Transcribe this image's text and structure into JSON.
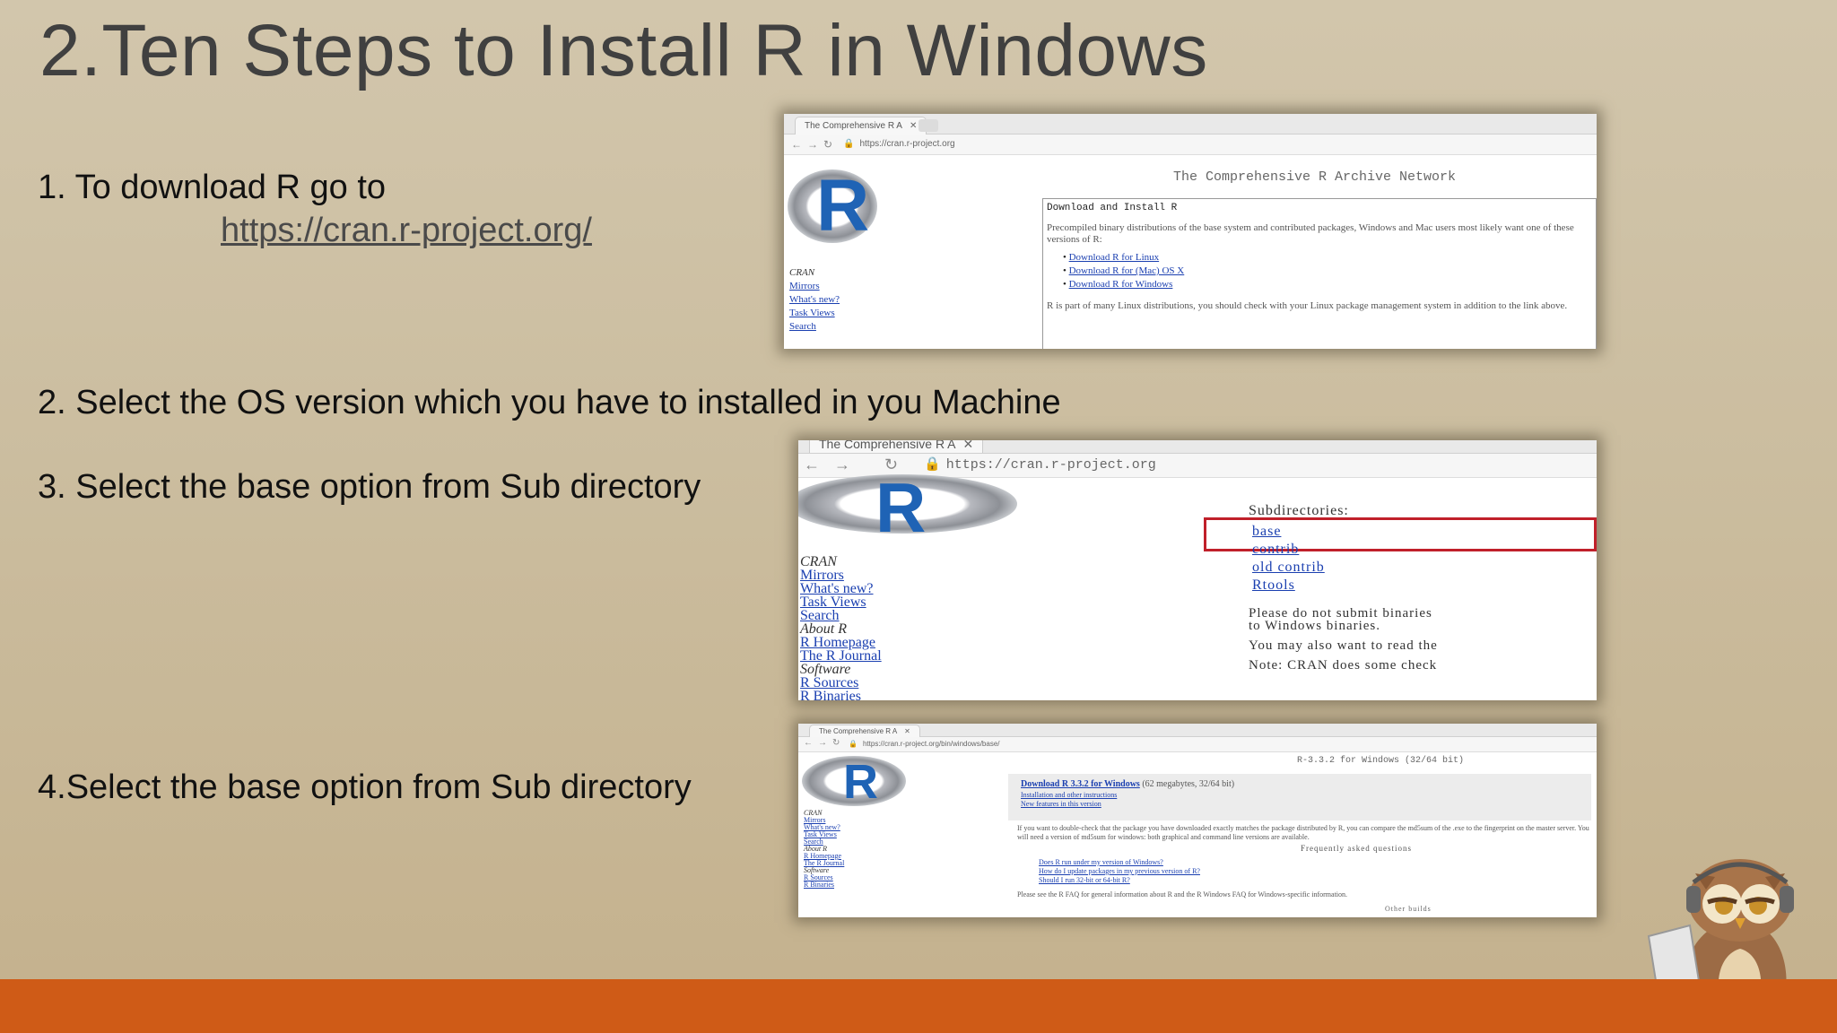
{
  "title": "2.Ten Steps to Install R in Windows",
  "steps": {
    "step1": "1. To download R go to",
    "step1_url": "https://cran.r-project.org/",
    "step2": "2. Select the OS version which you have to installed in you Machine",
    "step3": "3. Select the base option from Sub directory",
    "step4": "4.Select the base option from Sub directory"
  },
  "screenshot1": {
    "tab_label": "The Comprehensive R A",
    "address": "https://cran.r-project.org",
    "logo_letter": "R",
    "heading": "The Comprehensive R Archive Network",
    "box_title": "Download and Install R",
    "box_text": "Precompiled binary distributions of the base system and contributed packages, Windows and Mac users most likely want one of these versions of R:",
    "links": [
      "Download R for Linux",
      "Download R for (Mac) OS X",
      "Download R for Windows"
    ],
    "box_footer": "R is part of many Linux distributions, you should check with your Linux package management system in addition to the link above.",
    "side_links": [
      "CRAN",
      "Mirrors",
      "What's new?",
      "Task Views",
      "Search"
    ]
  },
  "screenshot2": {
    "tab_label": "The Comprehensive R A",
    "address": "https://cran.r-project.org",
    "logo_letter": "R",
    "sub_heading": "Subdirectories:",
    "sub_items": [
      "base",
      "contrib",
      "old contrib",
      "Rtools"
    ],
    "para1": "Please do not submit binaries",
    "para1b": "to Windows binaries.",
    "para2": "You may also want to read the",
    "para3": "Note: CRAN does some check",
    "side_links": [
      "CRAN",
      "Mirrors",
      "What's new?",
      "Task Views",
      "Search"
    ],
    "side_about": "About R",
    "side_about_links": [
      "R Homepage",
      "The R Journal"
    ],
    "side_software": "Software",
    "side_software_links": [
      "R Sources",
      "R Binaries"
    ]
  },
  "screenshot3": {
    "tab_label": "The Comprehensive R A",
    "address": "https://cran.r-project.org/bin/windows/base/",
    "logo_letter": "R",
    "heading": "R-3.3.2 for Windows (32/64 bit)",
    "download_link": "Download R 3.3.2 for Windows",
    "download_meta": "(62 megabytes, 32/64 bit)",
    "sublinks": [
      "Installation and other instructions",
      "New features in this version"
    ],
    "para": "If you want to double-check that the package you have downloaded exactly matches the package distributed by R, you can compare the md5sum of the .exe to the fingerprint on the master server. You will need a version of md5sum for windows: both graphical and command line versions are available.",
    "faq_heading": "Frequently asked questions",
    "faq_items": [
      "Does R run under my version of Windows?",
      "How do I update packages in my previous version of R?",
      "Should I run 32-bit or 64-bit R?"
    ],
    "footer_text": "Please see the R FAQ for general information about R and the R Windows FAQ for Windows-specific information.",
    "footer_builds": "Other builds",
    "side_links": [
      "CRAN",
      "Mirrors",
      "What's new?",
      "Task Views",
      "Search"
    ],
    "side_about": "About R",
    "side_about_links": [
      "R Homepage",
      "The R Journal"
    ],
    "side_software": "Software",
    "side_software_links": [
      "R Sources",
      "R Binaries"
    ]
  },
  "colors": {
    "footer_bar": "#cf5b17",
    "r_blue": "#1f63b5",
    "highlight_red": "#c0202a"
  }
}
